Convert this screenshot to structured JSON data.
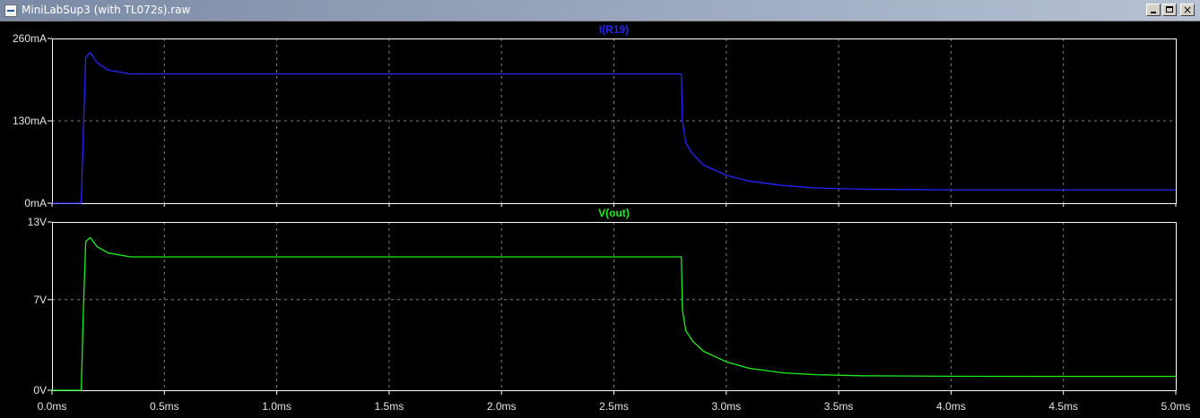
{
  "window": {
    "title": "MiniLabSup3 (with TL072s).raw",
    "buttons": {
      "minimize_icon": "minimize-icon",
      "maximize_icon": "maximize-icon",
      "close_icon": "close-icon",
      "close_glyph": "×"
    }
  },
  "colors": {
    "background": "#000000",
    "frame": "#ffffff",
    "grid": "#808080",
    "trace_current": "#2424ff",
    "trace_voltage": "#18f018"
  },
  "chart_data": [
    {
      "type": "line",
      "title": "I(R19)",
      "series": [
        {
          "name": "I(R19)",
          "x": [
            0,
            0.13,
            0.14,
            0.15,
            0.17,
            0.2,
            0.25,
            0.35,
            2.8,
            2.805,
            2.82,
            2.85,
            2.9,
            3.0,
            3.1,
            3.25,
            3.4,
            3.6,
            4.0,
            4.5,
            5.0
          ],
          "y": [
            0,
            0,
            120,
            230,
            238,
            222,
            210,
            204,
            204,
            130,
            95,
            78,
            60,
            44,
            35,
            28,
            24,
            22,
            21,
            21,
            21
          ]
        }
      ],
      "ylim": [
        0,
        260
      ],
      "y_unit": "mA",
      "yticks": [
        "260mA",
        "130mA",
        "0mA"
      ],
      "ytick_values": [
        260,
        130,
        0
      ],
      "xlim": [
        0,
        5
      ],
      "grid": true
    },
    {
      "type": "line",
      "title": "V(out)",
      "series": [
        {
          "name": "V(out)",
          "x": [
            0,
            0.13,
            0.14,
            0.15,
            0.17,
            0.2,
            0.25,
            0.35,
            2.8,
            2.805,
            2.82,
            2.85,
            2.9,
            3.0,
            3.1,
            3.25,
            3.4,
            3.6,
            4.0,
            4.5,
            5.0
          ],
          "y": [
            0,
            0,
            6.5,
            11.5,
            11.8,
            11.1,
            10.6,
            10.3,
            10.3,
            6.2,
            4.6,
            3.8,
            3.0,
            2.2,
            1.7,
            1.35,
            1.2,
            1.12,
            1.08,
            1.07,
            1.07
          ]
        }
      ],
      "ylim": [
        0,
        13
      ],
      "y_unit": "V",
      "yticks": [
        "13V",
        "7V",
        "0V"
      ],
      "ytick_values": [
        13,
        7,
        0
      ],
      "xlim": [
        0,
        5
      ],
      "grid": true
    }
  ],
  "x_axis": {
    "ticks": [
      "0.0ms",
      "0.5ms",
      "1.0ms",
      "1.5ms",
      "2.0ms",
      "2.5ms",
      "3.0ms",
      "3.5ms",
      "4.0ms",
      "4.5ms",
      "5.0ms"
    ],
    "tick_values": [
      0,
      0.5,
      1.0,
      1.5,
      2.0,
      2.5,
      3.0,
      3.5,
      4.0,
      4.5,
      5.0
    ],
    "unit": "ms"
  }
}
